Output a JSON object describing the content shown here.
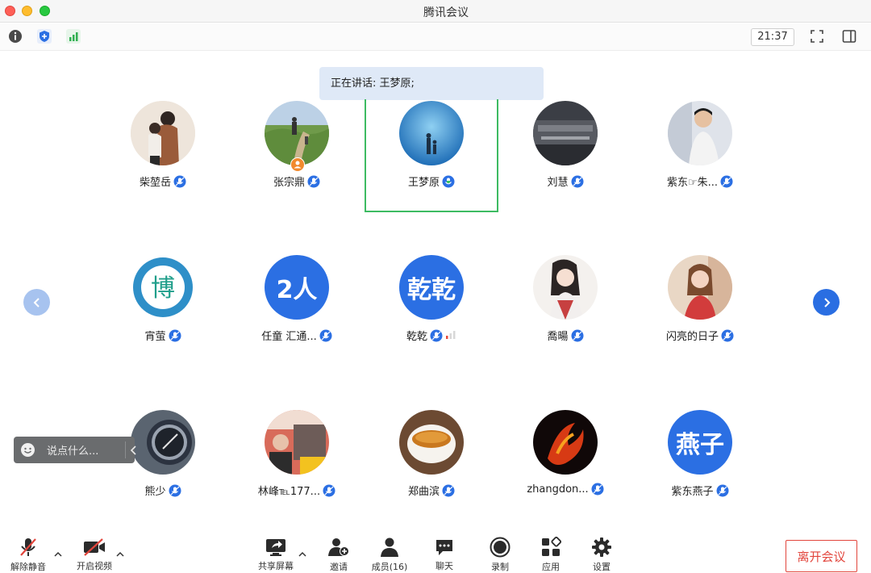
{
  "window": {
    "title": "腾讯会议",
    "time": "21:37"
  },
  "banner": {
    "speaking": "正在讲话: 王梦原;"
  },
  "participants": [
    {
      "name": "柴堃岳",
      "avatar": "photo-couple",
      "mic": "on"
    },
    {
      "name": "张宗鼎",
      "avatar": "photo-path",
      "mic": "on",
      "host_badge": true
    },
    {
      "name": "王梦原",
      "avatar": "photo-aquarium",
      "mic": "speaking"
    },
    {
      "name": "刘慧",
      "avatar": "photo-museum",
      "mic": "on"
    },
    {
      "name": "紫东☞朱...",
      "avatar": "photo-man",
      "mic": "on"
    },
    {
      "name": "宵萤",
      "avatar": "logo-bo",
      "mic": "on"
    },
    {
      "name": "任童 汇通...",
      "avatar_text": "2人",
      "avatar_color": "#2b6fe3",
      "mic": "on"
    },
    {
      "name": "乾乾",
      "avatar_text": "乾乾",
      "avatar_color": "#2b6fe3",
      "mic": "on",
      "signal": true
    },
    {
      "name": "喬暘",
      "avatar": "photo-anime-girl",
      "mic": "on"
    },
    {
      "name": "闪亮的日子",
      "avatar": "photo-woman",
      "mic": "on"
    },
    {
      "name": "熊少",
      "avatar": "photo-watch",
      "mic": "on"
    },
    {
      "name": "林峰℡177...",
      "avatar": "photo-sign",
      "mic": "on"
    },
    {
      "name": "郑曲滨",
      "avatar": "photo-tea",
      "mic": "on"
    },
    {
      "name": "zhangdon...",
      "avatar": "photo-fire",
      "mic": "on"
    },
    {
      "name": "紫东燕子",
      "avatar_text": "燕子",
      "avatar_color": "#2b6fe3",
      "mic": "on"
    }
  ],
  "chat_popup": {
    "placeholder": "说点什么..."
  },
  "toolbar": {
    "unmute": "解除静音",
    "start_video": "开启视频",
    "share_screen": "共享屏幕",
    "invite": "邀请",
    "members": "成员(16)",
    "chat": "聊天",
    "record": "录制",
    "apps": "应用",
    "settings": "设置",
    "leave": "离开会议"
  },
  "colors": {
    "accent": "#2b6fe3",
    "speaking_border": "#3dbb62",
    "leave": "#e2453c",
    "banner_bg": "#dfe9f7"
  }
}
